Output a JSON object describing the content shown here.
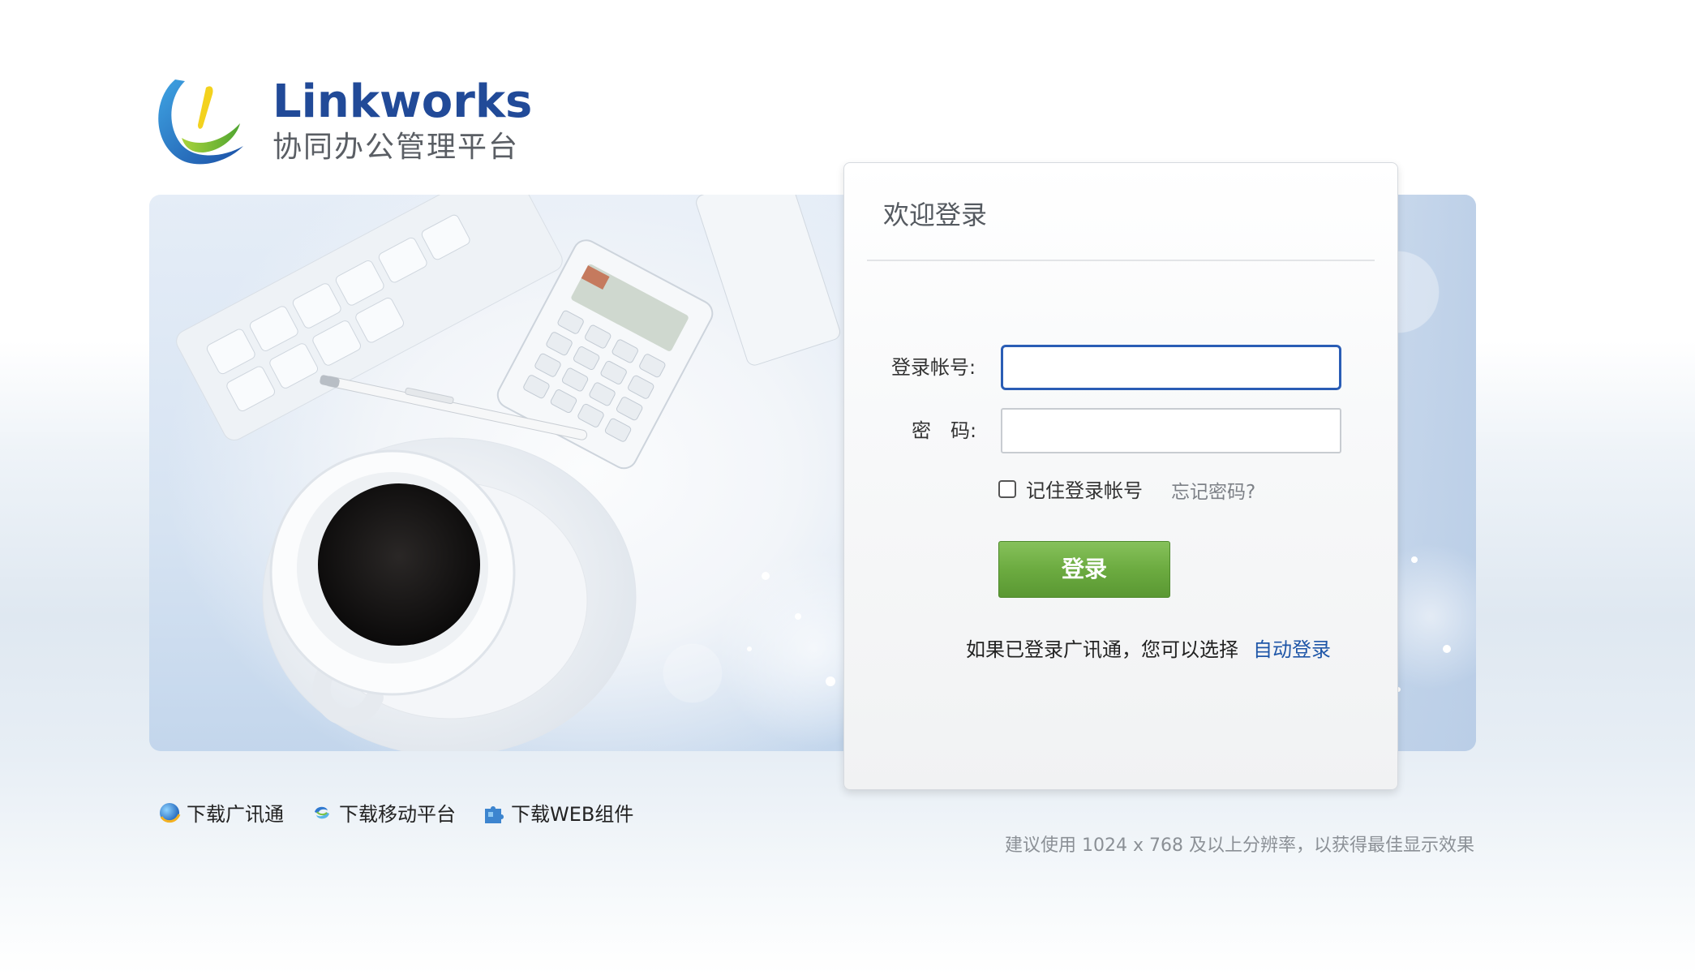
{
  "logo": {
    "title": "Linkworks",
    "subtitle": "协同办公管理平台"
  },
  "login": {
    "title": "欢迎登录",
    "username_label": "登录帐号:",
    "password_label": "密　码:",
    "username_value": "",
    "password_value": "",
    "remember_label": "记住登录帐号",
    "remember_checked": false,
    "forgot_label": "忘记密码?",
    "submit_label": "登录",
    "auto_login_prefix": "如果已登录广讯通，您可以选择",
    "auto_login_link": "自动登录"
  },
  "downloads": [
    {
      "label": "下载广讯通",
      "icon": "globe-icon"
    },
    {
      "label": "下载移动平台",
      "icon": "mobile-swirl-icon"
    },
    {
      "label": "下载WEB组件",
      "icon": "puzzle-icon"
    }
  ],
  "footer_hint": "建议使用 1024 x 768 及以上分辨率，以获得最佳显示效果",
  "colors": {
    "brand_blue": "#214a98",
    "link_blue": "#1f56a8",
    "button_green": "#6cab40",
    "focus_border": "#2a5db5"
  }
}
